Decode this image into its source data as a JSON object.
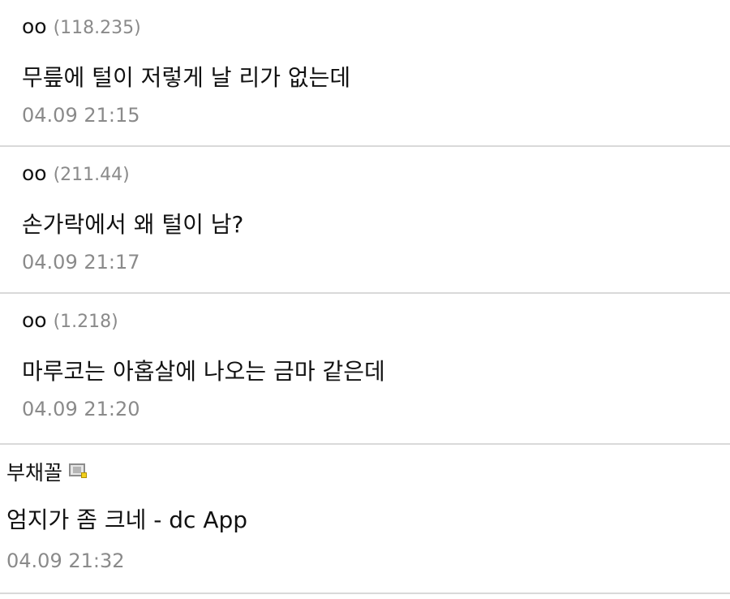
{
  "comments": [
    {
      "author": "oo",
      "ip": "(118.235)",
      "text": "무릎에 털이 저렇게 날 리가 없는데",
      "date": "04.09 21:15"
    },
    {
      "author": "oo",
      "ip": "(211.44)",
      "text": "손가락에서 왜 털이 남?",
      "date": "04.09 21:17"
    },
    {
      "author": "oo",
      "ip": "(1.218)",
      "text": "마루코는 아홉살에 나오는 금마 같은데",
      "date": "04.09 21:20"
    },
    {
      "author": "부채꼴",
      "member_icon": "member-badge-icon",
      "text": "엄지가 좀 크네 - dc App",
      "date": "04.09 21:32"
    }
  ],
  "colors": {
    "text": "#111111",
    "meta": "#8a8a8a",
    "divider": "#d9d9d9",
    "badge_dot": "#f2d01d"
  }
}
